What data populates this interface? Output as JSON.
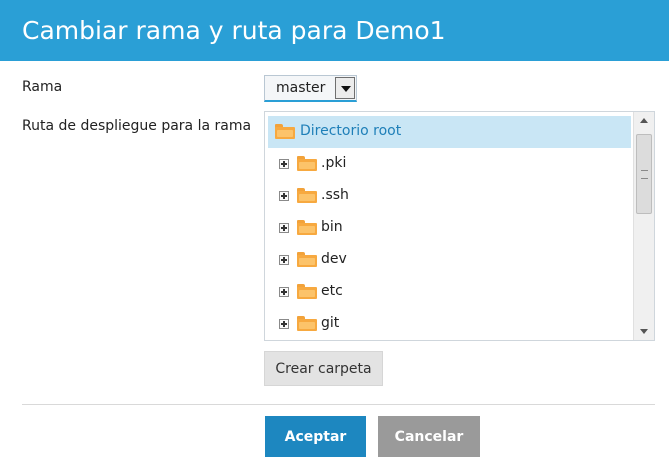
{
  "dialog": {
    "title": "Cambiar rama y ruta para Demo1"
  },
  "form": {
    "branch_label": "Rama",
    "branch_value": "master",
    "path_label": "Ruta de despliegue para la rama"
  },
  "tree": {
    "root": "Directorio root",
    "items": [
      ".pki",
      ".ssh",
      "bin",
      "dev",
      "etc",
      "git"
    ]
  },
  "buttons": {
    "create_folder": "Crear carpeta",
    "accept": "Aceptar",
    "cancel": "Cancelar"
  },
  "colors": {
    "header": "#2a9fd6",
    "accept": "#1d87c0",
    "cancel": "#9a9a9a",
    "selected_row": "#c9e6f5",
    "folder": "#f7a940"
  }
}
